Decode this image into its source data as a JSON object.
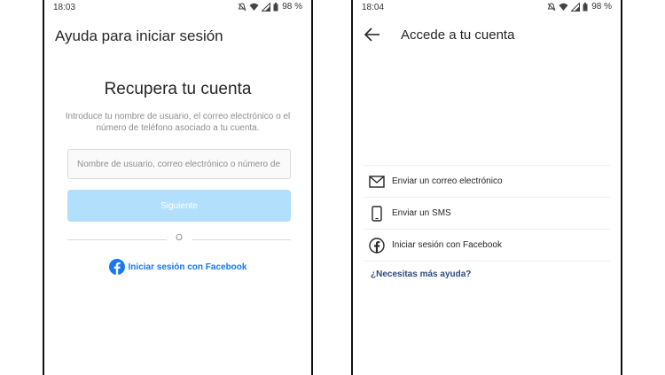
{
  "phone1": {
    "status": {
      "time": "18:03",
      "battery": "98 %"
    },
    "header": "Ayuda para iniciar sesión",
    "title": "Recupera tu cuenta",
    "description": "Introduce tu nombre de usuario, el correo electrónico o el número de teléfono asociado a tu cuenta.",
    "input_placeholder": "Nombre de usuario, correo electrónico o número de teléfono",
    "next_label": "Siguiente",
    "or_label": "O",
    "facebook_label": "Iniciar sesión con Facebook",
    "colors": {
      "facebook": "#1877f2",
      "button_disabled": "#b2dffc"
    }
  },
  "phone2": {
    "status": {
      "time": "18:04",
      "battery": "98 %"
    },
    "header": "Accede a tu cuenta",
    "options": [
      {
        "icon": "envelope-icon",
        "label": "Enviar un correo electrónico"
      },
      {
        "icon": "phone-icon",
        "label": "Enviar un SMS"
      },
      {
        "icon": "facebook-icon",
        "label": "Iniciar sesión con Facebook"
      }
    ],
    "help_label": "¿Necesitas más ayuda?"
  }
}
